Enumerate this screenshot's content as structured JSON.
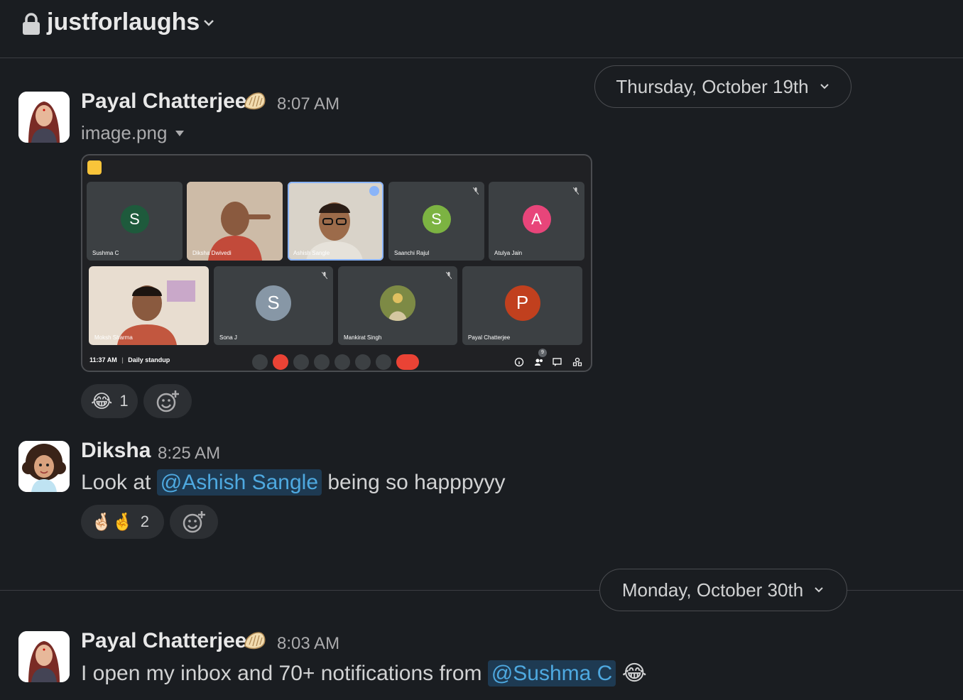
{
  "channel": {
    "name": "justforlaughs",
    "icon": "lock-icon",
    "private": true
  },
  "date_dividers": [
    {
      "label": "Thursday, October 19th"
    },
    {
      "label": "Monday, October 30th"
    }
  ],
  "messages": [
    {
      "author": "Payal Chatterjee",
      "status_emoji": "dumpling",
      "time": "8:07 AM",
      "file": {
        "name": "image.png",
        "meeting": {
          "tiles_row1": [
            {
              "name": "Sushma C",
              "initial": "S",
              "color": "#1e5a3c"
            },
            {
              "name": "Diksha Dwivedi",
              "photo": true
            },
            {
              "name": "Ashish Sangle",
              "photo": true,
              "active": true
            },
            {
              "name": "Saanchi Rajul",
              "initial": "S",
              "color": "#7cb342"
            },
            {
              "name": "Atulya Jain",
              "initial": "A",
              "color": "#e8457a"
            }
          ],
          "tiles_row2": [
            {
              "name": "Moksh Sharma",
              "photo": true
            },
            {
              "name": "Sona J",
              "initial": "S",
              "color": "#8797a6"
            },
            {
              "name": "Mankirat Singh",
              "photo": true
            },
            {
              "name": "Payal Chatterjee",
              "initial": "P",
              "color": "#c1401e"
            }
          ],
          "clock": "11:37 AM",
          "meeting_name": "Daily standup",
          "people_count": "9"
        }
      },
      "reactions": [
        {
          "emoji": "😂",
          "count": "1"
        }
      ]
    },
    {
      "author": "Diksha",
      "time": "8:25 AM",
      "text_before": "Look at",
      "mention": "@Ashish Sangle",
      "text_after": "being so happpyyy",
      "reactions": [
        {
          "emoji": "🤞🏻🤞",
          "count": "2"
        }
      ]
    },
    {
      "author": "Payal Chatterjee",
      "status_emoji": "dumpling",
      "time": "8:03 AM",
      "text_before": "I open my inbox and 70+ notifications from",
      "mention": "@Sushma C",
      "trailing_emoji": "😂"
    }
  ]
}
